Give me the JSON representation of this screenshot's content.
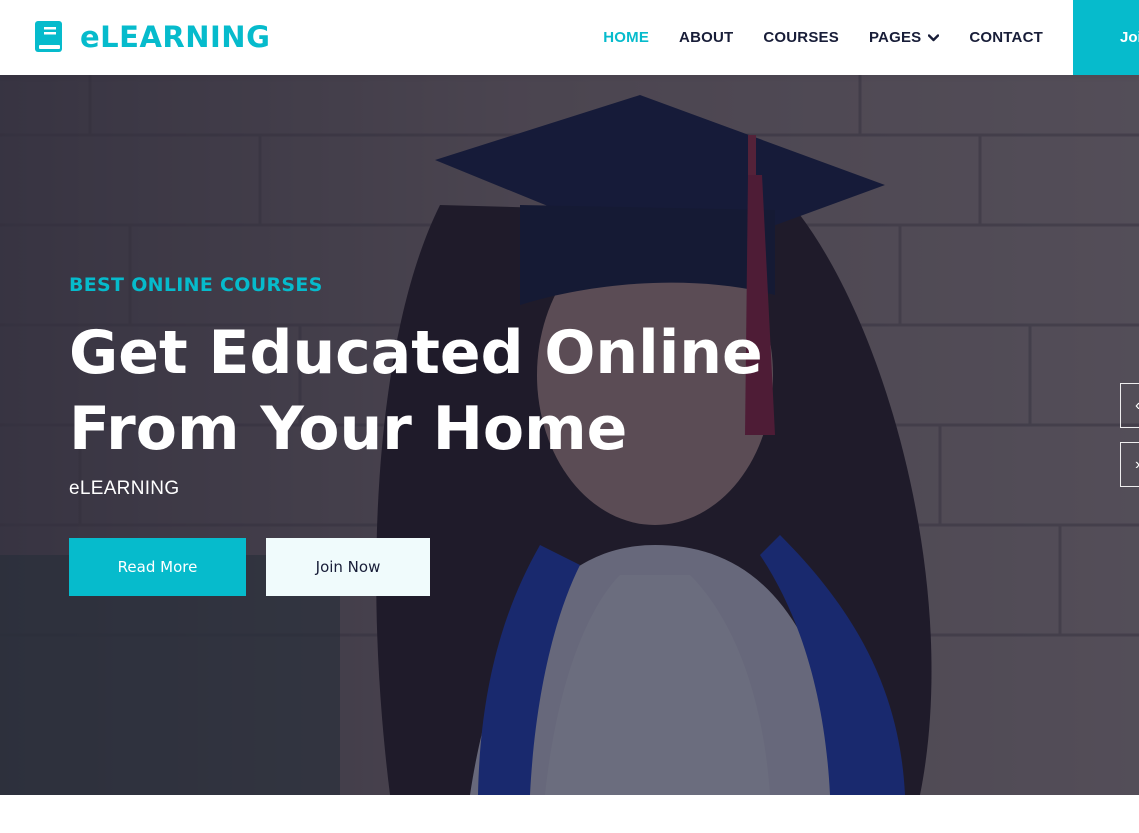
{
  "brand": {
    "name": "eLEARNING",
    "icon": "book-icon",
    "color": "#06BBCC"
  },
  "nav": {
    "items": [
      {
        "label": "HOME",
        "active": true
      },
      {
        "label": "ABOUT"
      },
      {
        "label": "COURSES"
      },
      {
        "label": "PAGES",
        "dropdown": true
      },
      {
        "label": "CONTACT"
      }
    ],
    "cta_label": "Join Now"
  },
  "hero": {
    "subtitle": "BEST ONLINE COURSES",
    "title_line1": "Get Educated Online",
    "title_line2": "From Your Home",
    "description": "eLEARNING",
    "read_more": "Read More",
    "join_now": "Join Now",
    "image": "graduate-woman-photo",
    "carousel_prev_icon": "chevron-left-icon",
    "carousel_next_icon": "chevron-right-icon"
  },
  "colors": {
    "accent": "#06BBCC",
    "dark": "#181d38",
    "light": "#F0FBFC"
  }
}
